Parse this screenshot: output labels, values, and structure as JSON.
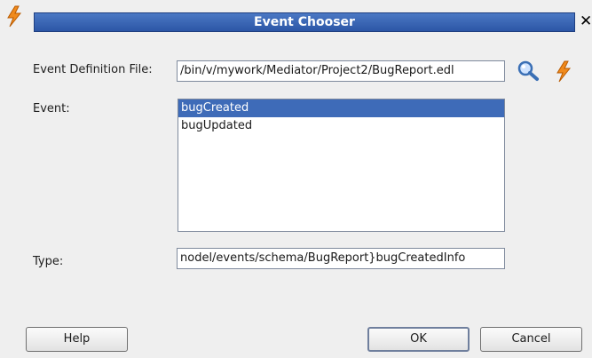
{
  "window": {
    "title": "Event Chooser"
  },
  "form": {
    "event_definition_label": "Event Definition File:",
    "event_definition_value": "∕bin/v/mywork/Mediator/Project2/BugReport.edl",
    "event_label": "Event:",
    "events": [
      "bugCreated",
      "bugUpdated"
    ],
    "selected_event_index": 0,
    "type_label": "Type:",
    "type_value": "nodel/events/schema/BugReport}bugCreatedInfo"
  },
  "buttons": {
    "help": "Help",
    "ok": "OK",
    "cancel": "Cancel"
  },
  "icons": {
    "title": "lightning-icon",
    "search": "magnifier-icon",
    "generate": "lightning-icon",
    "close": "close-icon"
  },
  "colors": {
    "title_bar": "#2c56a6",
    "selection": "#3e6bb8",
    "lightning": "#f08a1c"
  }
}
